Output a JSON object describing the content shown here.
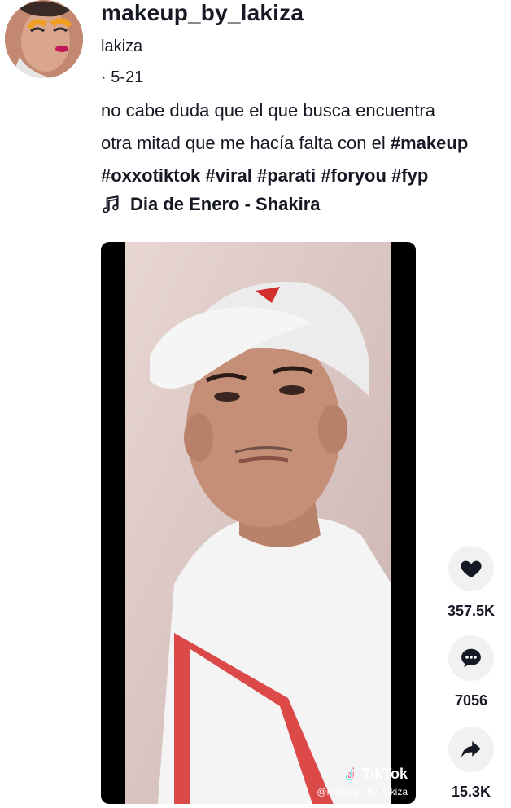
{
  "author": {
    "username": "makeup_by_lakiza",
    "nickname": "lakiza",
    "date": "· 5-21"
  },
  "caption": {
    "line1": "no cabe duda que el que busca encuentra",
    "line2_text": "otra mitad que me hacía falta con el ",
    "line2_tag": "#makeup",
    "line3": "#oxxotiktok #viral #parati #foryou #fyp"
  },
  "music": {
    "icon": "music-note-icon",
    "title": "Dia de Enero - Shakira"
  },
  "video": {
    "watermark_brand": "TikTok",
    "watermark_handle": "@makeup_by_lakiza"
  },
  "actions": {
    "likes": "357.5K",
    "comments": "7056",
    "shares": "15.3K",
    "icons": [
      "heart-icon",
      "comment-icon",
      "share-icon"
    ]
  },
  "colors": {
    "text": "#161823",
    "button_bg": "#f1f1f2"
  }
}
